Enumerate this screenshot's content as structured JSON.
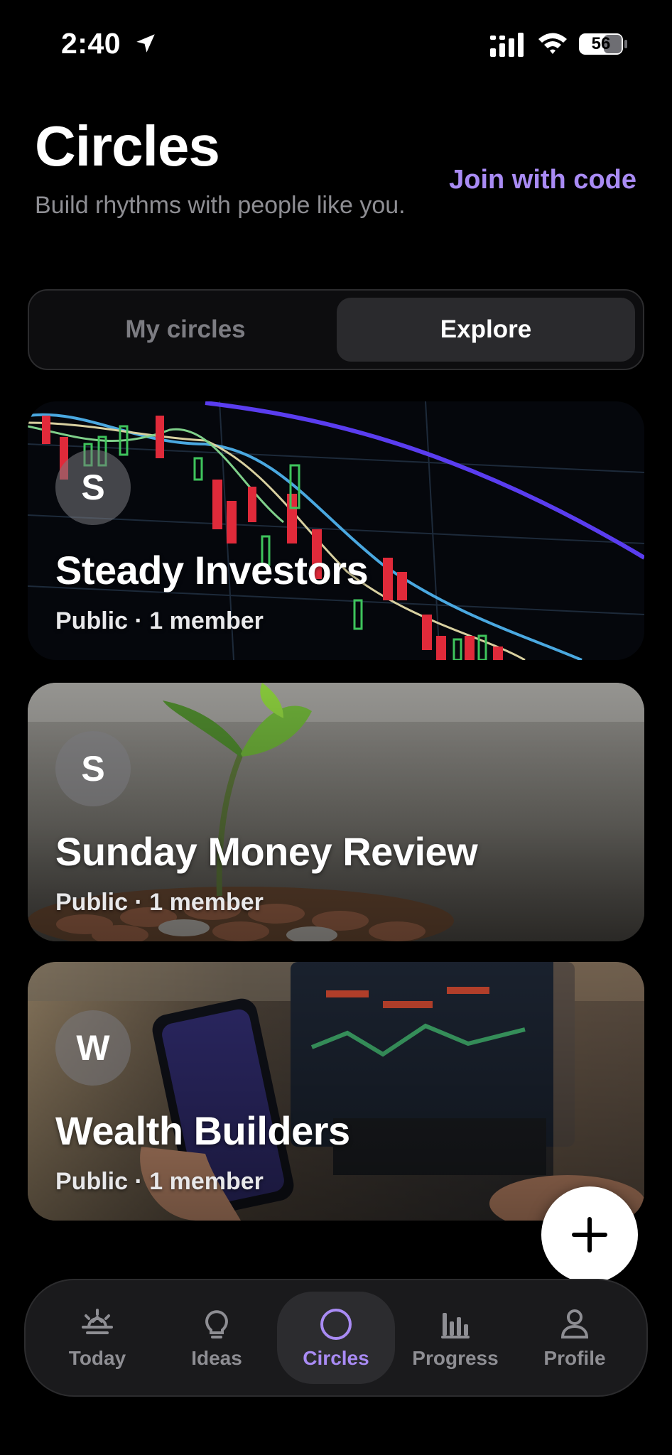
{
  "status_bar": {
    "time": "2:40",
    "battery": "56",
    "icons": [
      "location-arrow-icon",
      "cellular-signal-icon",
      "wifi-icon",
      "battery-icon"
    ]
  },
  "header": {
    "title": "Circles",
    "subtitle": "Build rhythms with people like you.",
    "join_link": "Join with code"
  },
  "segmented": {
    "options": [
      "My circles",
      "Explore"
    ],
    "selected": "Explore"
  },
  "circles": [
    {
      "initial": "S",
      "name": "Steady Investors",
      "meta": "Public · 1 member"
    },
    {
      "initial": "S",
      "name": "Sunday Money Review",
      "meta": "Public · 1 member"
    },
    {
      "initial": "W",
      "name": "Wealth Builders",
      "meta": "Public · 1 member"
    }
  ],
  "fab": {
    "icon": "plus-icon"
  },
  "tabbar": {
    "tabs": [
      {
        "label": "Today",
        "icon": "sunrise-icon"
      },
      {
        "label": "Ideas",
        "icon": "lightbulb-icon"
      },
      {
        "label": "Circles",
        "icon": "circle-icon"
      },
      {
        "label": "Progress",
        "icon": "bar-chart-icon"
      },
      {
        "label": "Profile",
        "icon": "person-icon"
      }
    ],
    "active": "Circles"
  },
  "colors": {
    "accent": "#a98bf4",
    "background": "#000000",
    "tabbar_bg": "#1a1a1c",
    "muted_text": "#8e8e93"
  }
}
